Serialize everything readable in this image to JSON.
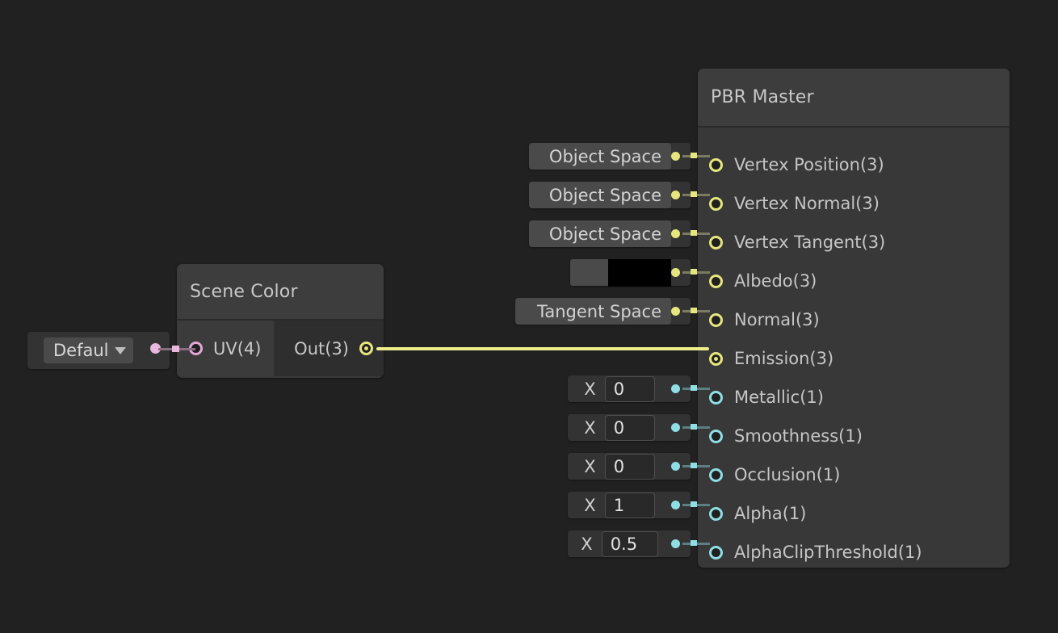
{
  "canvas": {
    "background": "#212121"
  },
  "nodes": {
    "pbr_master": {
      "title": "PBR Master",
      "slots": [
        {
          "label": "Vertex Position(3)",
          "type": "vector",
          "connected": false,
          "widget": "dropdown",
          "value": "Object Space"
        },
        {
          "label": "Vertex Normal(3)",
          "type": "vector",
          "connected": false,
          "widget": "dropdown",
          "value": "Object Space"
        },
        {
          "label": "Vertex Tangent(3)",
          "type": "vector",
          "connected": false,
          "widget": "dropdown",
          "value": "Object Space"
        },
        {
          "label": "Albedo(3)",
          "type": "vector",
          "connected": false,
          "widget": "color",
          "value": "#000000"
        },
        {
          "label": "Normal(3)",
          "type": "vector",
          "connected": false,
          "widget": "dropdown",
          "value": "Tangent Space"
        },
        {
          "label": "Emission(3)",
          "type": "vector",
          "connected": true,
          "widget": "none",
          "value": ""
        },
        {
          "label": "Metallic(1)",
          "type": "float",
          "connected": false,
          "widget": "float",
          "value": "0",
          "axis": "X"
        },
        {
          "label": "Smoothness(1)",
          "type": "float",
          "connected": false,
          "widget": "float",
          "value": "0",
          "axis": "X"
        },
        {
          "label": "Occlusion(1)",
          "type": "float",
          "connected": false,
          "widget": "float",
          "value": "0",
          "axis": "X"
        },
        {
          "label": "Alpha(1)",
          "type": "float",
          "connected": false,
          "widget": "float",
          "value": "1",
          "axis": "X"
        },
        {
          "label": "AlphaClipThreshold(1)",
          "type": "float",
          "connected": false,
          "widget": "float",
          "value": "0.5",
          "axis": "X"
        }
      ]
    },
    "scene_color": {
      "title": "Scene Color",
      "input_slot": "UV(4)",
      "output_slot": "Out(3)"
    },
    "uv_default": {
      "dropdown_value": "Defaul"
    }
  },
  "colors": {
    "vector_port": "#e6e67e",
    "float_port": "#8fdde5",
    "uv_port": "#e3a8d6",
    "emission_wire": "#eeee8c",
    "uv_wire": "#e9b6dd",
    "node_body": "#383838",
    "node_header": "#3d3d3d"
  }
}
